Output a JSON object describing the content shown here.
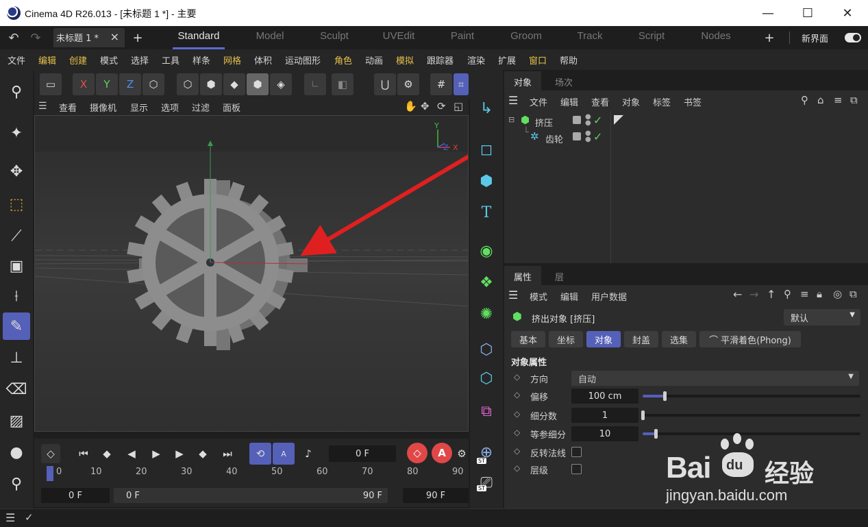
{
  "window": {
    "title": "Cinema 4D R26.013 - [未标题 1 *] - 主要",
    "minimize": "—",
    "maximize": "☐",
    "close": "✕"
  },
  "tabs": {
    "document": "未标题 1 *",
    "document_close": "×",
    "add": "+",
    "layouts": [
      "Standard",
      "Model",
      "Sculpt",
      "UVEdit",
      "Paint",
      "Groom",
      "Track",
      "Script",
      "Nodes"
    ],
    "active_layout": "Standard",
    "new_ui_label": "新界面"
  },
  "menu": [
    "文件",
    "编辑",
    "创建",
    "模式",
    "选择",
    "工具",
    "样条",
    "网格",
    "体积",
    "运动图形",
    "角色",
    "动画",
    "模拟",
    "跟踪器",
    "渲染",
    "扩展",
    "窗口",
    "帮助"
  ],
  "toolbar": {
    "axis_x": "X",
    "axis_y": "Y",
    "axis_z": "Z"
  },
  "viewport": {
    "menu": [
      "查看",
      "摄像机",
      "显示",
      "选项",
      "过滤",
      "面板"
    ],
    "axis_y": "Y",
    "axis_z": "Z",
    "axis_x": "X"
  },
  "timeline": {
    "current_frame": "0 F",
    "ruler": [
      "0",
      "10",
      "20",
      "30",
      "40",
      "50",
      "60",
      "70",
      "80",
      "90"
    ],
    "start_field": "0 F",
    "range_start": "0 F",
    "range_end": "90 F",
    "end_field": "90 F",
    "auto_key_label": "A",
    "record_label": "A"
  },
  "palette_labels": {
    "text_tool": "T",
    "st_badge": "ST"
  },
  "object_manager": {
    "tabs": [
      "对象",
      "场次"
    ],
    "menu": [
      "文件",
      "编辑",
      "查看",
      "对象",
      "标签",
      "书签"
    ],
    "objects": [
      {
        "name": "挤压",
        "color": "#f0c040"
      },
      {
        "name": "齿轮",
        "color": "#f0a030"
      }
    ]
  },
  "attributes": {
    "tabs": [
      "属性",
      "层"
    ],
    "menu": [
      "模式",
      "编辑",
      "用户数据"
    ],
    "object_title": "挤出对象 [挤压]",
    "preset": "默认",
    "subtabs": [
      "基本",
      "坐标",
      "对象",
      "封盖",
      "选集",
      "平滑着色(Phong)"
    ],
    "active_subtab": "对象",
    "section": "对象属性",
    "props": {
      "direction_label": "方向",
      "direction_value": "自动",
      "offset_label": "偏移",
      "offset_value": "100 cm",
      "offset_fraction": 0.1,
      "subdiv_label": "细分数",
      "subdiv_value": "1",
      "subdiv_fraction": 0.0,
      "iso_label": "等参细分",
      "iso_value": "10",
      "iso_fraction": 0.06,
      "reverse_label": "反转法线",
      "hierarchy_label": "层级"
    }
  },
  "watermark": {
    "brand": "Bai",
    "brand_du": "du",
    "brand_cn": "经验",
    "url": "jingyan.baidu.com"
  },
  "colors": {
    "accent": "#5560b8",
    "arrow": "#e02020",
    "menu_highlight": "#e6c04a",
    "green_check": "#5bd35b"
  }
}
